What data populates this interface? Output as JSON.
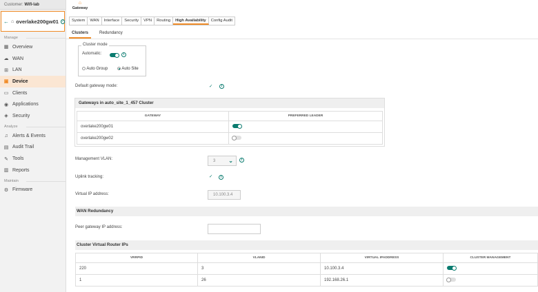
{
  "sidebar": {
    "customer_prefix": "Customer:",
    "customer_name": "Wifi-lab",
    "device_name": "overlake200gw01",
    "sections": {
      "manage": "Manage",
      "analyze": "Analyze",
      "maintain": "Maintain"
    },
    "items": {
      "overview": "Overview",
      "wan": "WAN",
      "lan": "LAN",
      "device": "Device",
      "clients": "Clients",
      "applications": "Applications",
      "security": "Security",
      "alerts": "Alerts & Events",
      "audit": "Audit Trail",
      "tools": "Tools",
      "reports": "Reports",
      "firmware": "Firmware"
    }
  },
  "topbar": {
    "gateway_label": "Gateway"
  },
  "tabs": [
    "System",
    "WAN",
    "Interface",
    "Security",
    "VPN",
    "Routing",
    "High Availability",
    "Config Audit"
  ],
  "active_tab": "High Availability",
  "subtabs": [
    "Clusters",
    "Redundancy"
  ],
  "active_subtab": "Clusters",
  "cluster_mode": {
    "legend": "Cluster mode",
    "automatic_label": "Automatic:",
    "automatic_on": true,
    "options": [
      "Auto Group",
      "Auto Site"
    ],
    "selected": "Auto Site"
  },
  "default_gateway_label": "Default gateway mode:",
  "gateways_panel": {
    "title": "Gateways in auto_site_1_457 Cluster",
    "columns": [
      "GATEWAY",
      "PREFERRED LEADER"
    ],
    "rows": [
      {
        "gateway": "overlake200gw01",
        "leader": true
      },
      {
        "gateway": "overlake200gw02",
        "leader": false
      }
    ]
  },
  "management_vlan": {
    "label": "Management VLAN:",
    "value": "3"
  },
  "uplink_tracking_label": "Uplink tracking:",
  "virtual_ip": {
    "label": "Virtual IP address:",
    "value": "10.100.3.4"
  },
  "wan_redundancy": {
    "title": "WAN Redundancy",
    "peer_label": "Peer gateway IP address:",
    "peer_value": ""
  },
  "cvr": {
    "title": "Cluster Virtual Router IPs",
    "columns": [
      "VRRPID",
      "VLANID",
      "VIRTUAL IPADDRESS",
      "CLUSTER MANAGEMENT"
    ],
    "rows": [
      {
        "vrrpid": "220",
        "vlanid": "3",
        "vip": "10.100.3.4",
        "mgmt": true
      },
      {
        "vrrpid": "1",
        "vlanid": "26",
        "vip": "192.168.26.1",
        "mgmt": false
      }
    ]
  },
  "colors": {
    "accent": "#f08a24",
    "toggle_on": "#0a7b6f"
  }
}
